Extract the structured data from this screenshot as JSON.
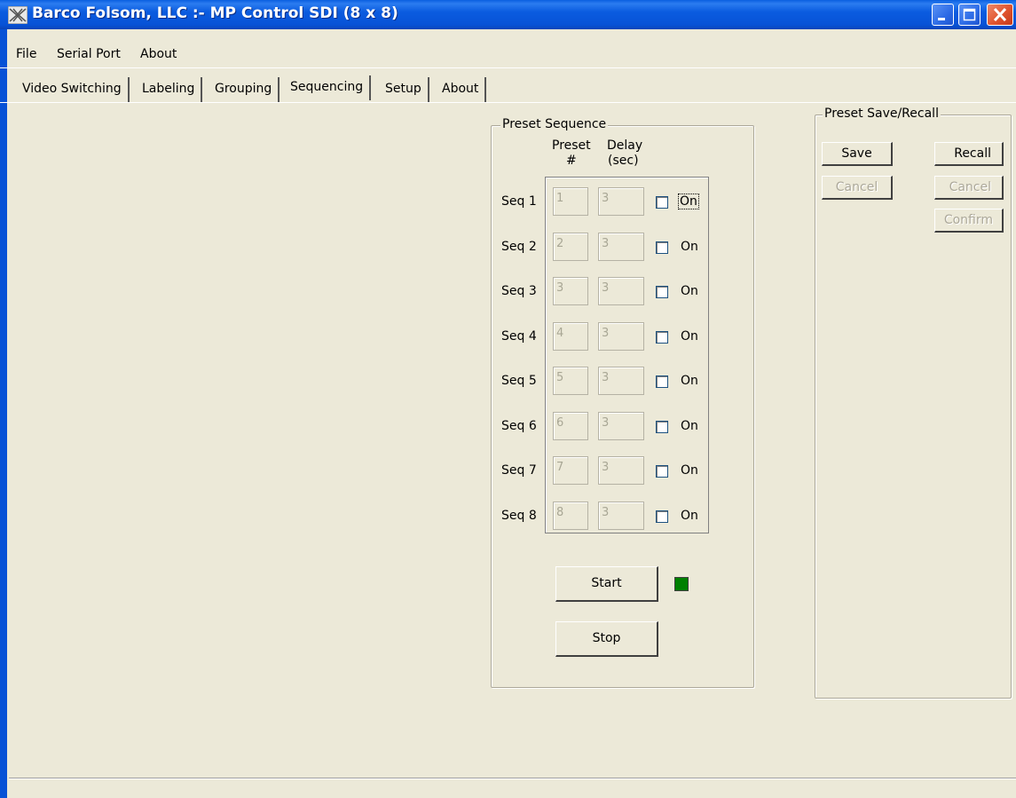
{
  "window": {
    "title": "Barco Folsom, LLC :- MP Control SDI (8 x 8)",
    "icons": [
      "app-icon",
      "minimize-icon",
      "maximize-icon",
      "close-icon"
    ]
  },
  "menu": [
    "File",
    "Serial Port",
    "About"
  ],
  "tabs": [
    {
      "label": "Video Switching",
      "active": false
    },
    {
      "label": "Labeling",
      "active": false
    },
    {
      "label": "Grouping",
      "active": false
    },
    {
      "label": "Sequencing",
      "active": true
    },
    {
      "label": "Setup",
      "active": false
    },
    {
      "label": "About",
      "active": false
    }
  ],
  "preset_sequence": {
    "title": "Preset Sequence",
    "col_preset": "Preset",
    "col_preset_sub": "#",
    "col_delay": "Delay",
    "col_delay_sub": "(sec)",
    "rows": [
      {
        "label": "Seq 1",
        "preset": "1",
        "delay": "3",
        "on_label": "On",
        "checked": false
      },
      {
        "label": "Seq 2",
        "preset": "2",
        "delay": "3",
        "on_label": "On",
        "checked": false
      },
      {
        "label": "Seq 3",
        "preset": "3",
        "delay": "3",
        "on_label": "On",
        "checked": false
      },
      {
        "label": "Seq 4",
        "preset": "4",
        "delay": "3",
        "on_label": "On",
        "checked": false
      },
      {
        "label": "Seq 5",
        "preset": "5",
        "delay": "3",
        "on_label": "On",
        "checked": false
      },
      {
        "label": "Seq 6",
        "preset": "6",
        "delay": "3",
        "on_label": "On",
        "checked": false
      },
      {
        "label": "Seq 7",
        "preset": "7",
        "delay": "3",
        "on_label": "On",
        "checked": false
      },
      {
        "label": "Seq 8",
        "preset": "8",
        "delay": "3",
        "on_label": "On",
        "checked": false
      }
    ],
    "start_label": "Start",
    "stop_label": "Stop",
    "status_color": "#008000"
  },
  "preset_save_recall": {
    "title": "Preset Save/Recall",
    "save_label": "Save",
    "recall_label": "Recall",
    "cancel_save_label": "Cancel",
    "cancel_recall_label": "Cancel",
    "confirm_label": "Confirm"
  },
  "colors": {
    "titlebar": "#0752d6",
    "face": "#ece9d8",
    "disabled_text": "#aca899"
  }
}
